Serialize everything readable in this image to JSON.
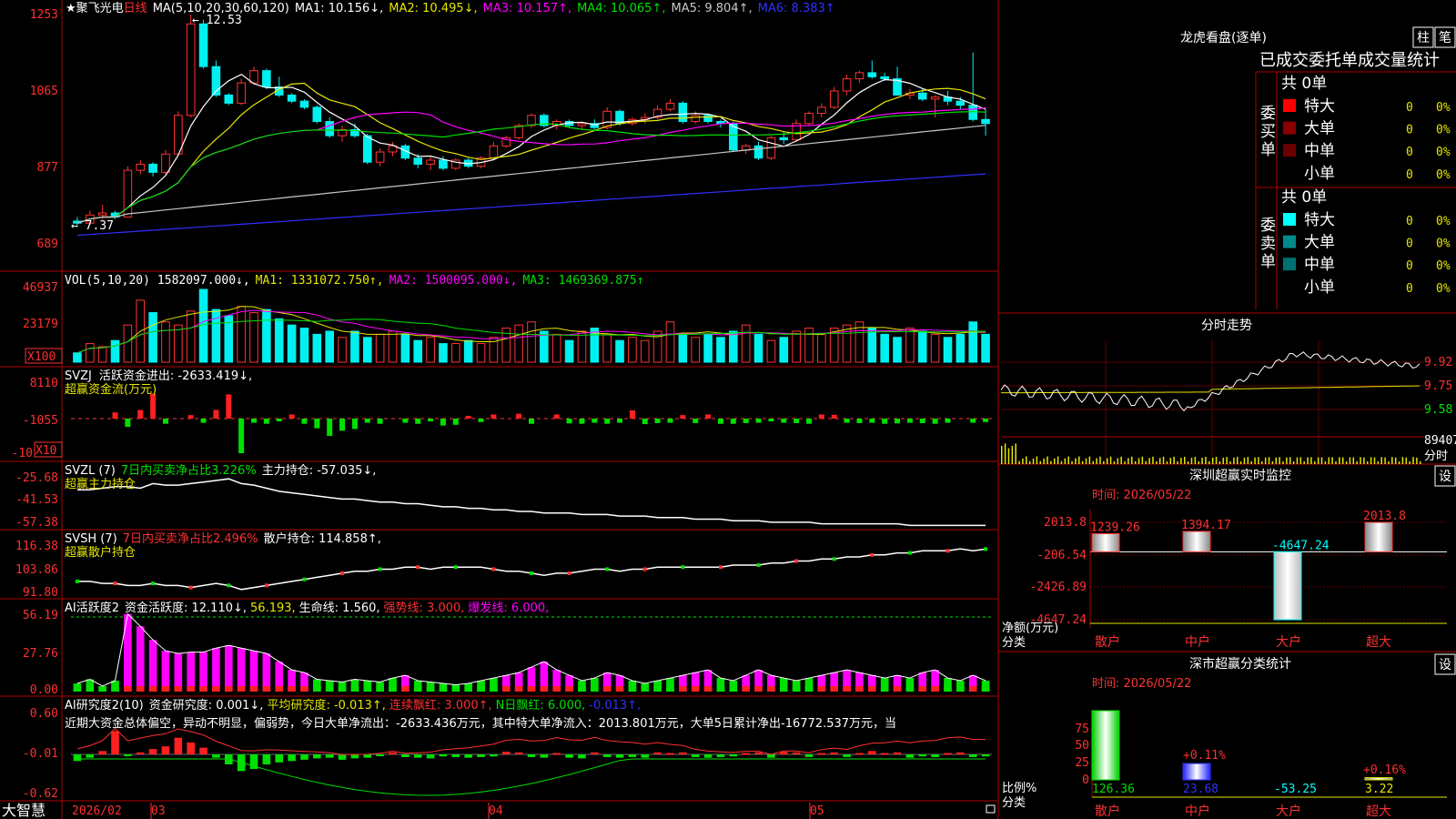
{
  "header": {
    "star": "★",
    "stock_name": "聚飞光电",
    "period": "日线",
    "ma_label": "MA(5,10,20,30,60,120)",
    "ma_values": [
      {
        "text": "MA1: 10.156↓,",
        "color": "#ffffff"
      },
      {
        "text": "MA2: 10.495↓,",
        "color": "#e6e600"
      },
      {
        "text": "MA3: 10.157↑,",
        "color": "#ff00ff"
      },
      {
        "text": "MA4: 10.065↑,",
        "color": "#00e000"
      },
      {
        "text": "MA5: 9.804↑,",
        "color": "#c8c8c8"
      },
      {
        "text": "MA6: 8.383↑",
        "color": "#3030ff"
      }
    ],
    "high_marker": "12.53",
    "low_marker": "7.37"
  },
  "axes": {
    "price_ticks": [
      "1253",
      "1065",
      "877",
      "689"
    ],
    "vol_ticks": [
      "46937",
      "23179"
    ],
    "vol_unit": "X100",
    "svzj_ticks": [
      "8110",
      "-1055",
      "-10"
    ],
    "svzj_unit": "X10",
    "svzl_ticks": [
      "-25.68",
      "-41.53",
      "-57.38"
    ],
    "svsh_ticks": [
      "116.38",
      "103.86",
      "91.80"
    ],
    "ai_act_ticks": [
      "56.19",
      "27.76",
      "0.00"
    ],
    "ai_res_ticks": [
      "0.60",
      "-0.01",
      "-0.62"
    ],
    "date_labels": [
      "2026/02",
      "03",
      "04",
      "05"
    ]
  },
  "panels": {
    "vol": {
      "title": "VOL(5,10,20)",
      "value": "1582097.000↓,",
      "ma1": "MA1: 1331072.750↑,",
      "ma2": "MA2: 1500095.000↓,",
      "ma3": "MA3: 1469369.875↑"
    },
    "svzj": {
      "title": "SVZJ",
      "value": "活跃资金进出: -2633.419↓,",
      "sub": "超赢资金流(万元)"
    },
    "svzl": {
      "title": "SVZL (7)",
      "ratio": "7日内买卖净占比3.226%",
      "hold": "主力持仓: -57.035↓,",
      "sub": "超赢主力持仓"
    },
    "svsh": {
      "title": "SVSH (7)",
      "ratio": "7日内买卖净占比2.496%",
      "hold": "散户持仓: 114.858↑,",
      "sub": "超赢散户持仓"
    },
    "ai_act": {
      "title": "AI活跃度2",
      "a": "资金活跃度: 12.110↓,",
      "b": "56.193,",
      "c": "生命线: 1.560,",
      "d": "强势线: 3.000,",
      "e": "爆发线: 6.000,"
    },
    "ai_res": {
      "title": "AI研究度2(10)",
      "a": "资金研究度: 0.001↓,",
      "b": "平均研究度: -0.013↑,",
      "c": "连续飘红: 3.000↑,",
      "d": "N日飘红: 6.000,",
      "e": "-0.013↑,",
      "commentary": "近期大资金总体偏空，异动不明显，偏弱势，今日大单净流出：-2633.436万元，其中特大单净流入：2013.801万元，大单5日累计净出-16772.537万元，当"
    }
  },
  "right": {
    "lhb_title": "龙虎看盘(逐单)",
    "btn_zhu": "柱",
    "btn_bi": "笔",
    "stats_header": "已成交委托单成交量统计",
    "buy": {
      "label": "委买单",
      "total": "共 0单",
      "rows": [
        {
          "name": "特大",
          "v": "0",
          "p": "0%",
          "color": "#ff0000"
        },
        {
          "name": "大单",
          "v": "0",
          "p": "0%",
          "color": "#8b0000"
        },
        {
          "name": "中单",
          "v": "0",
          "p": "0%",
          "color": "#6b0000"
        },
        {
          "name": "小单",
          "v": "0",
          "p": "0%",
          "color": ""
        }
      ]
    },
    "sell": {
      "label": "委卖单",
      "total": "共 0单",
      "rows": [
        {
          "name": "特大",
          "v": "0",
          "p": "0%",
          "color": "#00ffff"
        },
        {
          "name": "大单",
          "v": "0",
          "p": "0%",
          "color": "#008b8b"
        },
        {
          "name": "中单",
          "v": "0",
          "p": "0%",
          "color": "#007070"
        },
        {
          "name": "小单",
          "v": "0",
          "p": "0%",
          "color": ""
        }
      ]
    },
    "intraday": {
      "title": "分时走势",
      "ticks": [
        "9.92",
        "9.75",
        "9.58"
      ],
      "vol_tick": "89407",
      "vol_unit": "分时"
    },
    "monitor": {
      "title": "深圳超赢实时监控",
      "settings": "设",
      "time": "时间: 2026/05/22",
      "y_ticks": [
        "2013.8",
        "-206.54",
        "-2426.89",
        "-4647.24"
      ],
      "y_label": "净额(万元)",
      "x_label": "分类",
      "categories": [
        "散户",
        "中户",
        "大户",
        "超大"
      ],
      "values": [
        1239.26,
        1394.17,
        -4647.24,
        2013.8
      ],
      "value_labels": [
        "1239.26",
        "1394.17",
        "-4647.24",
        "2013.8"
      ]
    },
    "classify": {
      "title": "深市超赢分类统计",
      "settings": "设",
      "time": "时间: 2026/05/22",
      "y_ticks": [
        "75",
        "50",
        "25",
        "0"
      ],
      "y_label": "比例%",
      "x_label": "分类",
      "categories": [
        "散户",
        "中户",
        "大户",
        "超大"
      ],
      "pct_labels": [
        "",
        "+0.11%",
        "",
        "+0.16%"
      ],
      "bottom_values": [
        "126.36",
        "23.68",
        "-53.25",
        "3.22"
      ]
    }
  },
  "footer": {
    "brand": "大智慧"
  },
  "chart_data": [
    {
      "type": "candlestick",
      "title": "聚飞光电 日线",
      "ylim": [
        6.89,
        12.53
      ],
      "y_ticks": [
        6.89,
        8.77,
        10.65,
        12.53
      ],
      "x_labels": [
        "2026/02",
        "03",
        "04",
        "05"
      ],
      "ohlc": [
        [
          7.45,
          7.55,
          7.3,
          7.4
        ],
        [
          7.4,
          7.7,
          7.35,
          7.6
        ],
        [
          7.6,
          7.85,
          7.5,
          7.65
        ],
        [
          7.65,
          7.7,
          7.5,
          7.55
        ],
        [
          7.55,
          8.8,
          7.55,
          8.7
        ],
        [
          8.7,
          8.95,
          8.6,
          8.85
        ],
        [
          8.85,
          8.9,
          8.55,
          8.65
        ],
        [
          8.65,
          9.2,
          8.6,
          9.1
        ],
        [
          9.1,
          10.15,
          9.05,
          10.05
        ],
        [
          10.05,
          12.53,
          10.0,
          12.3
        ],
        [
          12.3,
          12.4,
          11.2,
          11.25
        ],
        [
          11.25,
          11.4,
          10.5,
          10.55
        ],
        [
          10.55,
          10.6,
          10.3,
          10.35
        ],
        [
          10.35,
          10.95,
          10.3,
          10.85
        ],
        [
          10.85,
          11.25,
          10.8,
          11.15
        ],
        [
          11.15,
          11.2,
          10.7,
          10.75
        ],
        [
          10.75,
          11.0,
          10.5,
          10.55
        ],
        [
          10.55,
          10.6,
          10.35,
          10.4
        ],
        [
          10.4,
          10.45,
          10.2,
          10.25
        ],
        [
          10.25,
          10.3,
          9.85,
          9.9
        ],
        [
          9.9,
          10.0,
          9.5,
          9.55
        ],
        [
          9.55,
          9.8,
          9.4,
          9.7
        ],
        [
          9.7,
          9.85,
          9.5,
          9.55
        ],
        [
          9.55,
          9.6,
          8.85,
          8.9
        ],
        [
          8.9,
          9.25,
          8.8,
          9.15
        ],
        [
          9.15,
          9.4,
          9.05,
          9.3
        ],
        [
          9.3,
          9.35,
          8.95,
          9.0
        ],
        [
          9.0,
          9.1,
          8.75,
          8.85
        ],
        [
          8.85,
          9.05,
          8.7,
          8.95
        ],
        [
          8.95,
          9.05,
          8.7,
          8.75
        ],
        [
          8.75,
          9.0,
          8.7,
          8.95
        ],
        [
          8.95,
          9.0,
          8.75,
          8.8
        ],
        [
          8.8,
          9.05,
          8.75,
          9.0
        ],
        [
          9.0,
          9.4,
          8.95,
          9.3
        ],
        [
          9.3,
          9.55,
          9.25,
          9.5
        ],
        [
          9.5,
          9.85,
          9.45,
          9.8
        ],
        [
          9.8,
          10.1,
          9.75,
          10.05
        ],
        [
          10.05,
          10.1,
          9.75,
          9.8
        ],
        [
          9.8,
          9.95,
          9.7,
          9.9
        ],
        [
          9.9,
          9.95,
          9.75,
          9.8
        ],
        [
          9.8,
          9.9,
          9.7,
          9.85
        ],
        [
          9.85,
          9.95,
          9.7,
          9.75
        ],
        [
          9.75,
          10.25,
          9.7,
          10.15
        ],
        [
          10.15,
          10.2,
          9.8,
          9.85
        ],
        [
          9.85,
          10.0,
          9.8,
          9.95
        ],
        [
          9.95,
          10.1,
          9.85,
          10.0
        ],
        [
          10.0,
          10.3,
          9.95,
          10.2
        ],
        [
          10.2,
          10.45,
          10.15,
          10.35
        ],
        [
          10.35,
          10.4,
          9.85,
          9.9
        ],
        [
          9.9,
          10.15,
          9.85,
          10.05
        ],
        [
          10.05,
          10.1,
          9.85,
          9.9
        ],
        [
          9.9,
          9.95,
          9.75,
          9.85
        ],
        [
          9.85,
          9.9,
          9.15,
          9.2
        ],
        [
          9.2,
          9.35,
          9.1,
          9.3
        ],
        [
          9.3,
          9.4,
          8.95,
          9.0
        ],
        [
          9.0,
          9.55,
          8.95,
          9.5
        ],
        [
          9.5,
          9.65,
          9.35,
          9.45
        ],
        [
          9.45,
          9.95,
          9.4,
          9.85
        ],
        [
          9.85,
          10.15,
          9.8,
          10.1
        ],
        [
          10.1,
          10.35,
          10.0,
          10.25
        ],
        [
          10.25,
          10.75,
          10.2,
          10.65
        ],
        [
          10.65,
          11.05,
          10.55,
          10.95
        ],
        [
          10.95,
          11.15,
          10.85,
          11.1
        ],
        [
          11.1,
          11.4,
          10.95,
          11.0
        ],
        [
          11.0,
          11.1,
          10.9,
          10.95
        ],
        [
          10.95,
          11.25,
          10.85,
          10.55
        ],
        [
          10.55,
          10.7,
          10.45,
          10.6
        ],
        [
          10.6,
          10.7,
          10.4,
          10.45
        ],
        [
          10.45,
          10.55,
          10.0,
          10.5
        ],
        [
          10.5,
          10.65,
          10.3,
          10.4
        ],
        [
          10.4,
          10.5,
          10.2,
          10.3
        ],
        [
          10.3,
          11.6,
          9.9,
          9.95
        ],
        [
          9.95,
          10.2,
          9.55,
          9.85
        ]
      ],
      "series": [
        {
          "name": "MA1",
          "color": "#ffffff"
        },
        {
          "name": "MA2",
          "color": "#e6e600"
        },
        {
          "name": "MA3",
          "color": "#ff00ff"
        },
        {
          "name": "MA4",
          "color": "#00e000"
        },
        {
          "name": "MA5",
          "color": "#c8c8c8"
        },
        {
          "name": "MA6",
          "color": "#3030ff"
        }
      ]
    },
    {
      "type": "bar",
      "title": "VOL(5,10,20)",
      "ylim": [
        0,
        46937
      ],
      "values": [
        6,
        12,
        10,
        14,
        24,
        40,
        32,
        26,
        24,
        33,
        47,
        34,
        30,
        36,
        32,
        34,
        28,
        24,
        22,
        18,
        20,
        16,
        20,
        16,
        18,
        20,
        18,
        14,
        16,
        12,
        12,
        14,
        12,
        16,
        22,
        24,
        26,
        20,
        18,
        14,
        20,
        22,
        18,
        14,
        16,
        14,
        20,
        26,
        18,
        16,
        18,
        16,
        20,
        24,
        18,
        14,
        16,
        20,
        22,
        18,
        22,
        24,
        26,
        22,
        18,
        16,
        22,
        20,
        18,
        16,
        18,
        26,
        18
      ]
    },
    {
      "type": "bar",
      "title": "SVZJ",
      "values": [
        0,
        0,
        0,
        1800,
        -2400,
        2500,
        7200,
        -1500,
        0,
        1000,
        -1200,
        2500,
        7000,
        -10000,
        -1200,
        -1500,
        -800,
        1200,
        -1500,
        -2800,
        -5000,
        -3500,
        -3000,
        -1200,
        -1500,
        0,
        -1200,
        -1500,
        -800,
        -2000,
        -1800,
        800,
        -1000,
        1200,
        0,
        1400,
        -1500,
        0,
        1200,
        -1400,
        -1500,
        -1200,
        -1500,
        -1200,
        2400,
        -1600,
        -1300,
        -1200,
        1000,
        -1300,
        1200,
        -1500,
        -1500,
        -1300,
        -1200,
        -800,
        -1200,
        -1300,
        -1500,
        1200,
        1100,
        -1200,
        -1300,
        -1200,
        -1500,
        -1400,
        -1200,
        -1300,
        -1500,
        -1200,
        0,
        -1200,
        -1000
      ]
    },
    {
      "type": "line",
      "title": "SVZL (7)",
      "ylim": [
        -57.38,
        -25.68
      ],
      "series": [
        {
          "name": "主力持仓",
          "values": [
            -34,
            -34,
            -33,
            -32,
            -32,
            -33,
            -30,
            -31,
            -31,
            -30,
            -29,
            -28,
            -27,
            -30,
            -31,
            -33,
            -35,
            -36,
            -37,
            -38,
            -39,
            -40,
            -40,
            -41,
            -42,
            -42,
            -43,
            -43,
            -44,
            -45,
            -45,
            -46,
            -46,
            -47,
            -47,
            -48,
            -48,
            -49,
            -49,
            -49,
            -50,
            -50,
            -50,
            -51,
            -51,
            -51,
            -52,
            -52,
            -52,
            -53,
            -53,
            -53,
            -54,
            -54,
            -54,
            -55,
            -55,
            -55,
            -55,
            -56,
            -56,
            -56,
            -56,
            -56,
            -56,
            -56,
            -57,
            -57,
            -57,
            -57,
            -57,
            -57,
            -57.035
          ]
        }
      ]
    },
    {
      "type": "line",
      "title": "SVSH (7)",
      "ylim": [
        91.8,
        116.38
      ],
      "series": [
        {
          "name": "散户持仓",
          "values": [
            99,
            99,
            98,
            98,
            97,
            97,
            98,
            97,
            97,
            96,
            97,
            98,
            97,
            95,
            96,
            97,
            98,
            99,
            100,
            101,
            102,
            103,
            104,
            104,
            105,
            105,
            106,
            106,
            105,
            106,
            106,
            106,
            106,
            105,
            104,
            104,
            103,
            102,
            103,
            103,
            104,
            105,
            105,
            104,
            105,
            105,
            106,
            106,
            106,
            106,
            106,
            106,
            107,
            107,
            107,
            108,
            108,
            109,
            109,
            110,
            110,
            111,
            111,
            112,
            112,
            113,
            113,
            114,
            114,
            114,
            115,
            114,
            114.858
          ]
        }
      ]
    },
    {
      "type": "bar",
      "title": "AI活跃度2",
      "ylim": [
        0,
        56.19
      ],
      "values": [
        6,
        9,
        4,
        8,
        57,
        48,
        38,
        30,
        28,
        29,
        29,
        32,
        34,
        32,
        30,
        28,
        22,
        16,
        14,
        9,
        8,
        7,
        9,
        8,
        7,
        10,
        12,
        8,
        7,
        6,
        5,
        6,
        8,
        10,
        12,
        14,
        18,
        22,
        16,
        12,
        8,
        10,
        14,
        12,
        8,
        6,
        8,
        10,
        12,
        14,
        16,
        10,
        8,
        12,
        16,
        12,
        10,
        8,
        10,
        12,
        14,
        16,
        14,
        12,
        10,
        12,
        10,
        14,
        16,
        10,
        8,
        12,
        8
      ]
    },
    {
      "type": "bar",
      "title": "AI研究度2(10)",
      "ylim": [
        -0.62,
        0.6
      ],
      "values": [
        -0.1,
        -0.05,
        0.05,
        0.35,
        -0.02,
        0.03,
        0.08,
        0.12,
        0.25,
        0.18,
        0.1,
        -0.05,
        -0.15,
        -0.25,
        -0.22,
        -0.15,
        -0.12,
        -0.1,
        -0.08,
        -0.06,
        -0.05,
        -0.08,
        -0.06,
        -0.05,
        -0.02,
        0.03,
        -0.04,
        -0.05,
        -0.06,
        -0.03,
        -0.04,
        -0.05,
        -0.04,
        -0.03,
        0.04,
        0.03,
        -0.04,
        -0.05,
        0.02,
        -0.05,
        -0.06,
        0.03,
        -0.04,
        -0.05,
        -0.04,
        -0.05,
        0.03,
        0.02,
        0.03,
        -0.04,
        -0.05,
        -0.04,
        -0.03,
        0.02,
        0.03,
        -0.05,
        0.04,
        0.03,
        -0.04,
        0.02,
        0.03,
        -0.04,
        0.02,
        0.05,
        0.02,
        0.03,
        -0.05,
        -0.03,
        -0.04,
        0.02,
        0.03,
        -0.04,
        -0.03
      ]
    }
  ]
}
